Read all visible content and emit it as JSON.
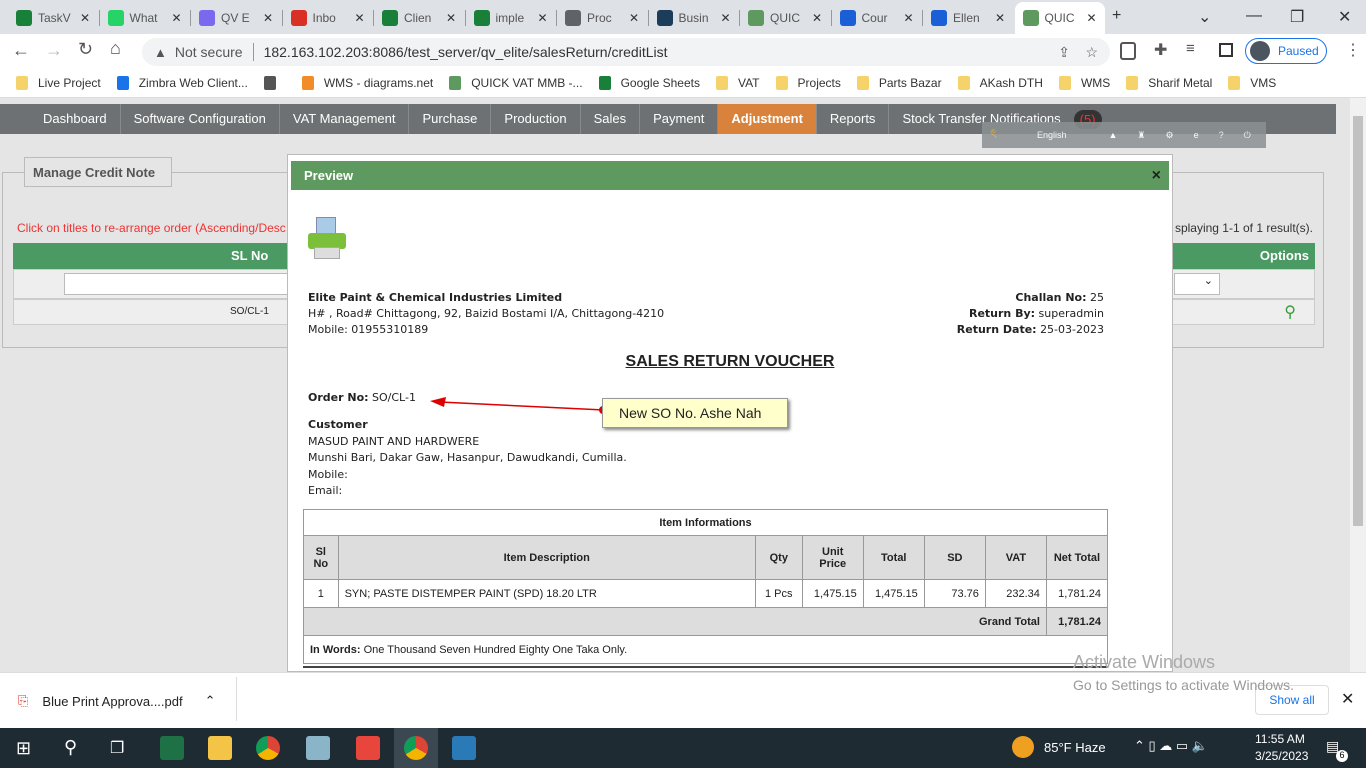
{
  "browser": {
    "tabs": [
      {
        "label": "TaskV",
        "icon": "sheets-icon",
        "color": "#188038"
      },
      {
        "label": "What",
        "icon": "whatsapp-icon",
        "color": "#25d366"
      },
      {
        "label": "QV E",
        "icon": "clickup-icon",
        "color": "#7b68ee"
      },
      {
        "label": "Inbo",
        "icon": "gmail-icon",
        "color": "#d93025"
      },
      {
        "label": "Clien",
        "icon": "sheets-icon",
        "color": "#188038"
      },
      {
        "label": "imple",
        "icon": "sheets-icon",
        "color": "#188038"
      },
      {
        "label": "Proc",
        "icon": "globe-icon",
        "color": "#5f6368"
      },
      {
        "label": "Busin",
        "icon": "business-icon",
        "color": "#1c3d5a"
      },
      {
        "label": "QUIC",
        "icon": "gear-icon",
        "color": "#5e9a60"
      },
      {
        "label": "Cour",
        "icon": "c-icon",
        "color": "#1a5fd6"
      },
      {
        "label": "Ellen",
        "icon": "c-icon",
        "color": "#1a5fd6"
      },
      {
        "label": "QUIC",
        "icon": "gear-icon",
        "color": "#5e9a60",
        "active": true
      }
    ],
    "not_secure": "Not secure",
    "url": "182.163.102.203:8086/test_server/qv_elite/salesReturn/creditList",
    "profile": "Paused",
    "bookmarks": [
      "Live Project",
      "Zimbra Web Client...",
      "",
      "WMS - diagrams.net",
      "QUICK VAT MMB -...",
      "Google Sheets",
      "VAT",
      "Projects",
      "Parts Bazar",
      "AKash DTH",
      "WMS",
      "Sharif Metal",
      "VMS"
    ]
  },
  "nav": {
    "items": [
      "Dashboard",
      "Software Configuration",
      "VAT Management",
      "Purchase",
      "Production",
      "Sales",
      "Payment",
      "Adjustment",
      "Reports",
      "Stock Transfer Notifications"
    ],
    "active": "Adjustment",
    "badge": "(5)",
    "language": "English"
  },
  "panel": {
    "title": "Manage Credit Note",
    "hint": "Click on titles to re-arrange order (Ascending/Desc",
    "results": "splaying 1-1 of 1 result(s).",
    "col_sl": "SL No",
    "col_options": "Options",
    "row_sl": "SO/CL-1"
  },
  "modal": {
    "title": "Preview",
    "close": "×",
    "company": "Elite Paint & Chemical Industries Limited",
    "address": "H# , Road# Chittagong, 92, Baizid Bostami I/A, Chittagong-4210",
    "mobile": "Mobile: 01955310189",
    "challan_label": "Challan No:",
    "challan": "25",
    "return_by_label": "Return By:",
    "return_by": "superadmin",
    "return_date_label": "Return Date:",
    "return_date": "25-03-2023",
    "voucher_title": "SALES RETURN VOUCHER",
    "order_label": "Order No:",
    "order_no": "SO/CL-1",
    "annotation": "New SO No. Ashe Nah",
    "customer_label": "Customer",
    "customer_name": "MASUD PAINT AND HARDWERE",
    "customer_address": "Munshi Bari, Dakar Gaw, Hasanpur, Dawudkandi, Cumilla.",
    "customer_mobile": "Mobile:",
    "customer_email": "Email:",
    "table_title": "Item Informations",
    "headers": [
      "Sl No",
      "Item Description",
      "Qty",
      "Unit Price",
      "Total",
      "SD",
      "VAT",
      "Net Total"
    ],
    "rows": [
      [
        "1",
        "SYN; PASTE DISTEMPER PAINT (SPD) 18.20 LTR",
        "1 Pcs",
        "1,475.15",
        "1,475.15",
        "73.76",
        "232.34",
        "1,781.24"
      ]
    ],
    "grand_total_label": "Grand Total",
    "grand_total": "1,781.24",
    "in_words_label": "In Words:",
    "in_words": "One Thousand Seven Hundred Eighty One Taka Only."
  },
  "watermark": {
    "line1": "Activate Windows",
    "line2": "Go to Settings to activate Windows."
  },
  "downloads": {
    "file": "Blue Print Approva....pdf",
    "show_all": "Show all"
  },
  "taskbar": {
    "weather": "85°F  Haze",
    "time": "11:55 AM",
    "date": "3/25/2023",
    "notifications": "6"
  }
}
